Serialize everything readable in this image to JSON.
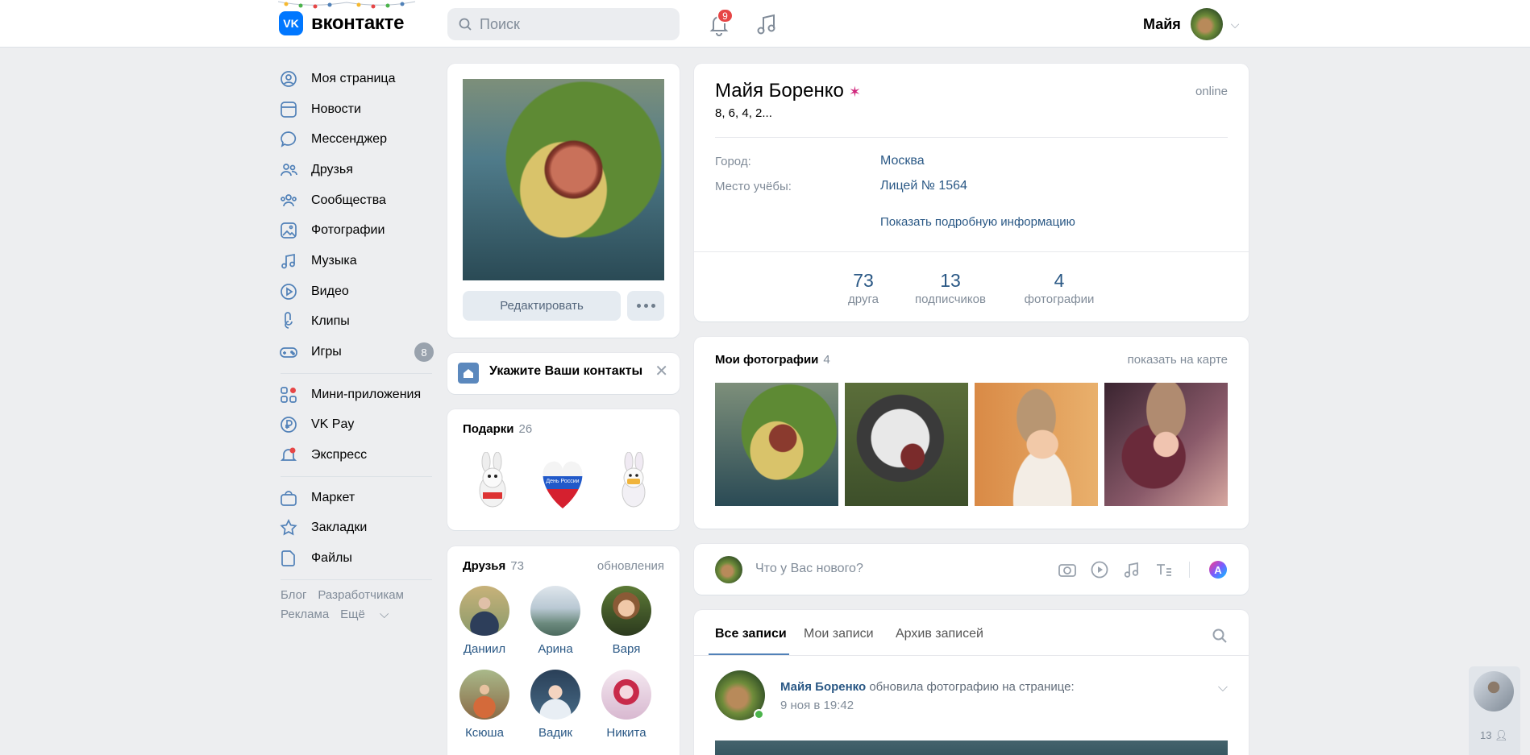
{
  "header": {
    "logo_text": "вконтакте",
    "logo_mark": "VK",
    "search_placeholder": "Поиск",
    "notifications_count": "9",
    "user_name": "Майя"
  },
  "nav": {
    "items": [
      {
        "label": "Моя страница",
        "icon": "user-circle-icon"
      },
      {
        "label": "Новости",
        "icon": "news-icon"
      },
      {
        "label": "Мессенджер",
        "icon": "message-icon"
      },
      {
        "label": "Друзья",
        "icon": "friends-icon"
      },
      {
        "label": "Сообщества",
        "icon": "communities-icon"
      },
      {
        "label": "Фотографии",
        "icon": "photo-icon"
      },
      {
        "label": "Музыка",
        "icon": "music-icon"
      },
      {
        "label": "Видео",
        "icon": "video-icon"
      },
      {
        "label": "Клипы",
        "icon": "clips-icon"
      },
      {
        "label": "Игры",
        "icon": "games-icon",
        "badge": "8"
      }
    ],
    "items2": [
      {
        "label": "Мини-приложения",
        "icon": "apps-icon"
      },
      {
        "label": "VK Pay",
        "icon": "vkpay-icon"
      },
      {
        "label": "Экспресс",
        "icon": "express-icon"
      }
    ],
    "items3": [
      {
        "label": "Маркет",
        "icon": "market-icon"
      },
      {
        "label": "Закладки",
        "icon": "bookmark-icon"
      },
      {
        "label": "Файлы",
        "icon": "file-icon"
      }
    ],
    "footer": {
      "blog": "Блог",
      "dev": "Разработчикам",
      "ads": "Реклама",
      "more": "Ещё"
    }
  },
  "avatar_card": {
    "edit_label": "Редактировать"
  },
  "contacts": {
    "text": "Укажите Ваши контакты"
  },
  "gifts": {
    "title": "Подарки",
    "count": "26",
    "heart_text": "День России"
  },
  "friends": {
    "title": "Друзья",
    "count": "73",
    "updates": "обновления",
    "list": [
      "Даниил",
      "Арина",
      "Варя",
      "Ксюша",
      "Вадик",
      "Никита"
    ]
  },
  "profile": {
    "name": "Майя Боренко",
    "status": "8, 6, 4, 2...",
    "online": "online",
    "city_label": "Город:",
    "city": "Москва",
    "school_label": "Место учёбы:",
    "school": "Лицей № 1564",
    "more_info": "Показать подробную информацию",
    "counters": [
      {
        "n": "73",
        "l": "друга"
      },
      {
        "n": "13",
        "l": "подписчиков"
      },
      {
        "n": "4",
        "l": "фотографии"
      }
    ]
  },
  "photos": {
    "title": "Мои фотографии",
    "count": "4",
    "map_link": "показать на карте"
  },
  "compose": {
    "placeholder": "Что у Вас нового?"
  },
  "wall": {
    "tabs": [
      "Все записи",
      "Мои записи",
      "Архив записей"
    ],
    "post_author": "Майя Боренко",
    "post_action": "обновила фотографию на странице:",
    "post_date": "9 ноя в 19:42"
  },
  "side_chat": {
    "count": "13"
  }
}
